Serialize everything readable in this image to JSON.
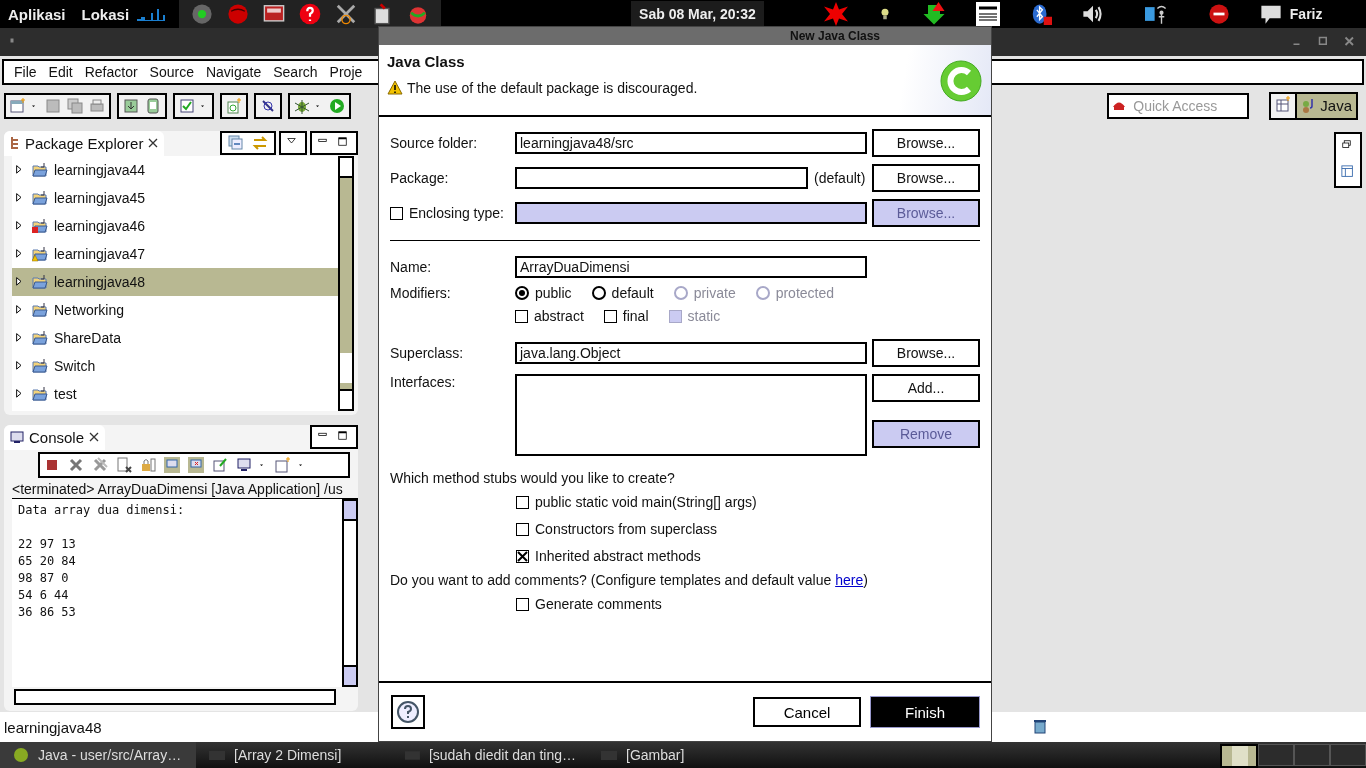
{
  "top_panel": {
    "menus": [
      "Aplikasi",
      "Lokasi"
    ],
    "clock": "Sab 08 Mar, 20:32",
    "user": "Fariz"
  },
  "window": {
    "menu": [
      "File",
      "Edit",
      "Refactor",
      "Source",
      "Navigate",
      "Search",
      "Proje"
    ],
    "quick_access": {
      "placeholder": "Quick Access"
    },
    "perspectives": [
      {
        "label": "Java",
        "selected": true
      }
    ]
  },
  "package_explorer": {
    "title": "Package Explorer",
    "items": [
      {
        "label": "learningjava44",
        "kind": "project",
        "selected": false
      },
      {
        "label": "learningjava45",
        "kind": "project",
        "selected": false
      },
      {
        "label": "learningjava46",
        "kind": "error",
        "selected": false
      },
      {
        "label": "learningjava47",
        "kind": "warning",
        "selected": false
      },
      {
        "label": "learningjava48",
        "kind": "project",
        "selected": true
      },
      {
        "label": "Networking",
        "kind": "project",
        "selected": false
      },
      {
        "label": "ShareData",
        "kind": "project",
        "selected": false
      },
      {
        "label": "Switch",
        "kind": "project",
        "selected": false
      },
      {
        "label": "test",
        "kind": "project",
        "selected": false
      }
    ]
  },
  "console": {
    "title": "Console",
    "header": "<terminated> ArrayDuaDimensi [Java Application] /us",
    "heading": "Data array dua dimensi:",
    "rows": [
      "22 97 13",
      "65 20 84",
      "98 87 0",
      "54 6 44",
      "36 86 53"
    ]
  },
  "status_bar": {
    "text": "learningjava48"
  },
  "taskbar": [
    {
      "label": "Java - user/src/Array…",
      "selected": true
    },
    {
      "label": "[Array 2 Dimensi]",
      "selected": false
    },
    {
      "label": "[sudah diedit dan ting…",
      "selected": false
    },
    {
      "label": "[Gambar]",
      "selected": false
    }
  ],
  "dialog": {
    "title": "New Java Class",
    "heading": "Java Class",
    "message": "The use of the default package is discouraged.",
    "source_folder": {
      "label": "Source folder:",
      "value": "learningjava48/src",
      "button": "Browse..."
    },
    "package": {
      "label": "Package:",
      "suffix": "(default)",
      "button": "Browse..."
    },
    "enclosing": {
      "label": "Enclosing type:",
      "checked": false,
      "disabled": true,
      "button": "Browse..."
    },
    "name": {
      "label": "Name:",
      "value": "ArrayDuaDimensi"
    },
    "modifiers": {
      "label": "Modifiers:",
      "access": [
        {
          "label": "public",
          "selected": true,
          "disabled": false
        },
        {
          "label": "default",
          "selected": false,
          "disabled": false
        },
        {
          "label": "private",
          "selected": false,
          "disabled": true
        },
        {
          "label": "protected",
          "selected": false,
          "disabled": true
        }
      ],
      "flags": [
        {
          "label": "abstract",
          "checked": false,
          "disabled": false
        },
        {
          "label": "final",
          "checked": false,
          "disabled": false
        },
        {
          "label": "static",
          "checked": false,
          "disabled": true
        }
      ]
    },
    "superclass": {
      "label": "Superclass:",
      "value": "java.lang.Object",
      "button": "Browse..."
    },
    "interfaces": {
      "label": "Interfaces:",
      "buttons": [
        {
          "label": "Add...",
          "disabled": false
        },
        {
          "label": "Remove",
          "disabled": true
        }
      ]
    },
    "stubs": {
      "question": "Which method stubs would you like to create?",
      "options": [
        {
          "label": "public static void main(String[] args)",
          "checked": false
        },
        {
          "label": "Constructors from superclass",
          "checked": false
        },
        {
          "label": "Inherited abstract methods",
          "checked": true
        }
      ]
    },
    "comments": {
      "question": "Do you want to add comments? (Configure templates and default value ",
      "link": "here",
      "question_end": ")",
      "options": [
        {
          "label": "Generate comments",
          "checked": false
        }
      ]
    },
    "buttons": [
      {
        "label": "Cancel",
        "default": false
      },
      {
        "label": "Finish",
        "default": true
      }
    ]
  }
}
